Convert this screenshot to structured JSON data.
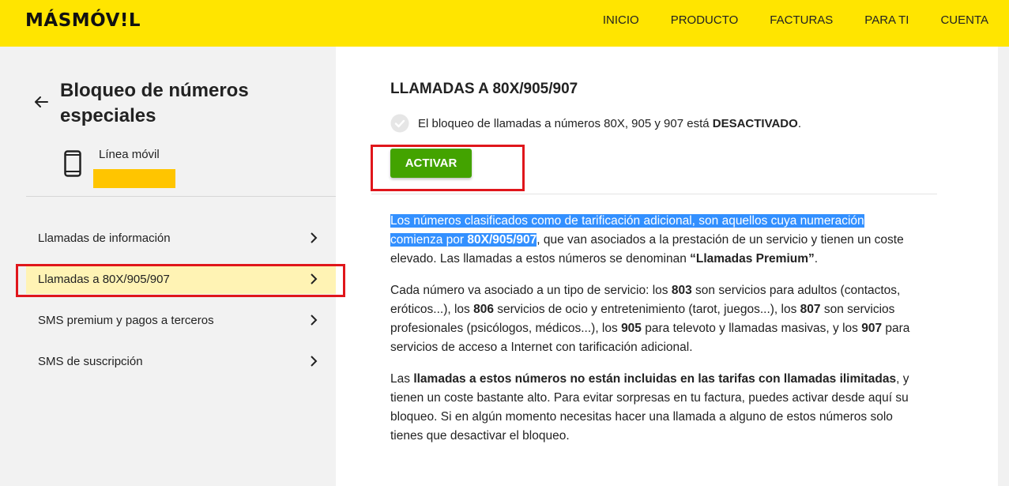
{
  "header": {
    "logo_main": "MÁSMÓV",
    "logo_bang": "!",
    "logo_end": "L",
    "nav": [
      "INICIO",
      "PRODUCTO",
      "FACTURAS",
      "PARA TI",
      "CUENTA"
    ]
  },
  "sidebar": {
    "title": "Bloqueo de números especiales",
    "line_label": "Línea móvil",
    "items": [
      {
        "label": "Llamadas de información"
      },
      {
        "label": "Llamadas a 80X/905/907"
      },
      {
        "label": "SMS premium y pagos a terceros"
      },
      {
        "label": "SMS de suscripción"
      }
    ],
    "active_index": 1
  },
  "main": {
    "title": "LLAMADAS A 80X/905/907",
    "status_prefix": "El bloqueo de llamadas a números 80X, 905 y 907 está ",
    "status_value": "DESACTIVADO",
    "status_suffix": ".",
    "activate_label": "ACTIVAR",
    "p1": {
      "sel_a": "Los números clasificados como de tarificación adicional, son aquellos cuya numeración comienza por ",
      "sel_b": "80X/905/907",
      "rest": ", que van asociados a la prestación de un servicio y tienen un coste elevado. Las llamadas a estos números se denominan ",
      "bold": "“Llamadas Premium”",
      "end": "."
    },
    "p2": {
      "t1": "Cada número va asociado a un tipo de servicio: los ",
      "b1": "803",
      "t2": " son servicios para adultos (contactos, eróticos...), los ",
      "b2": "806",
      "t3": " servicios de ocio y entretenimiento (tarot, juegos...), los ",
      "b3": "807",
      "t4": " son servicios profesionales (psicólogos, médicos...), los ",
      "b4": "905",
      "t5": " para televoto y llamadas masivas, y los ",
      "b5": "907",
      "t6": " para servicios de acceso a Internet con tarificación adicional."
    },
    "p3": {
      "t1": "Las ",
      "b1": "llamadas a estos números no están incluidas en las tarifas con llamadas ilimitadas",
      "t2": ", y tienen un coste bastante alto. Para evitar sorpresas en tu factura, puedes activar desde aquí su bloqueo. Si en algún momento necesitas hacer una llamada a alguno de estos números solo tienes que desactivar el bloqueo."
    }
  },
  "colors": {
    "brand_yellow": "#ffe500",
    "button_green": "#43a300",
    "annotation_red": "#e0161b",
    "selection_blue": "#3390ff"
  }
}
